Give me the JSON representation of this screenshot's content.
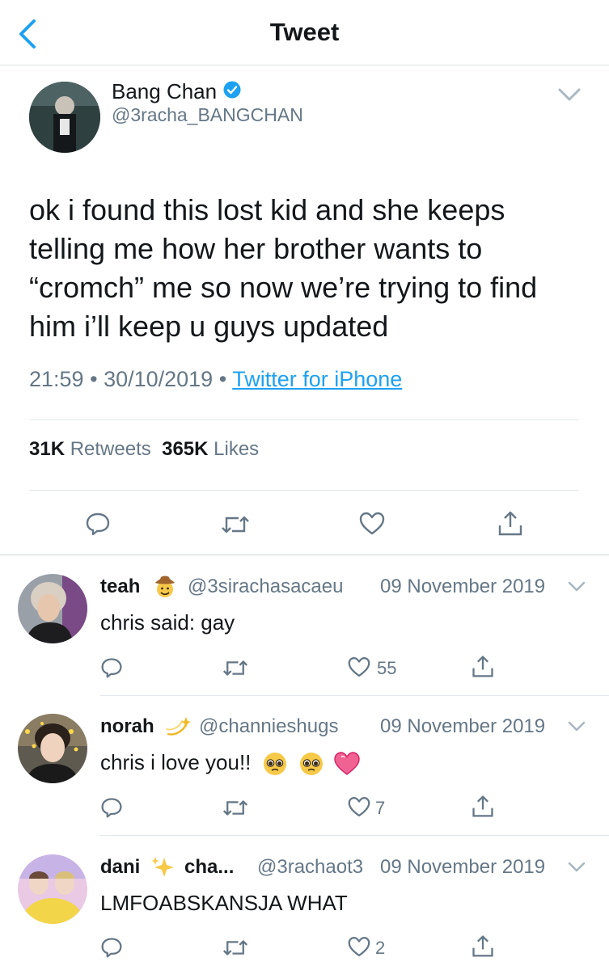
{
  "header": {
    "title": "Tweet"
  },
  "tweet": {
    "author_name": "Bang Chan",
    "author_handle": "@3racha_BANGCHAN",
    "text": "ok i found this lost kid and she keeps telling me how her brother wants to “cromch” me so now we’re trying to find him i’ll keep u guys updated",
    "time": "21:59",
    "date": "30/10/2019",
    "separator": "•",
    "source": "Twitter for iPhone",
    "retweets": "31K",
    "retweets_label": "Retweets",
    "likes": "365K",
    "likes_label": "Likes"
  },
  "replies": [
    {
      "name": "teah",
      "handle": "@3sirachasacaeu",
      "date": "09 November 2019",
      "text": "chris said: gay",
      "likes": "55",
      "emoji_icon": "cowboy-emoji"
    },
    {
      "name": "norah",
      "handle": "@channieshugs",
      "date": "09 November 2019",
      "text": "chris i love you!!",
      "likes": "7",
      "emoji_icon": "dizzy-emoji"
    },
    {
      "name": "dani",
      "name_suffix": "cha...",
      "handle": "@3rachaot3",
      "date": "09 November 2019",
      "text": "LMFOABSKANSJA WHAT",
      "likes": "2",
      "emoji_icon": "sparkles-emoji"
    }
  ],
  "colors": {
    "accent": "#1da1f2",
    "text": "#14171a",
    "muted": "#657786",
    "divider": "#e1e8ed",
    "verified": "#1da1f2"
  }
}
